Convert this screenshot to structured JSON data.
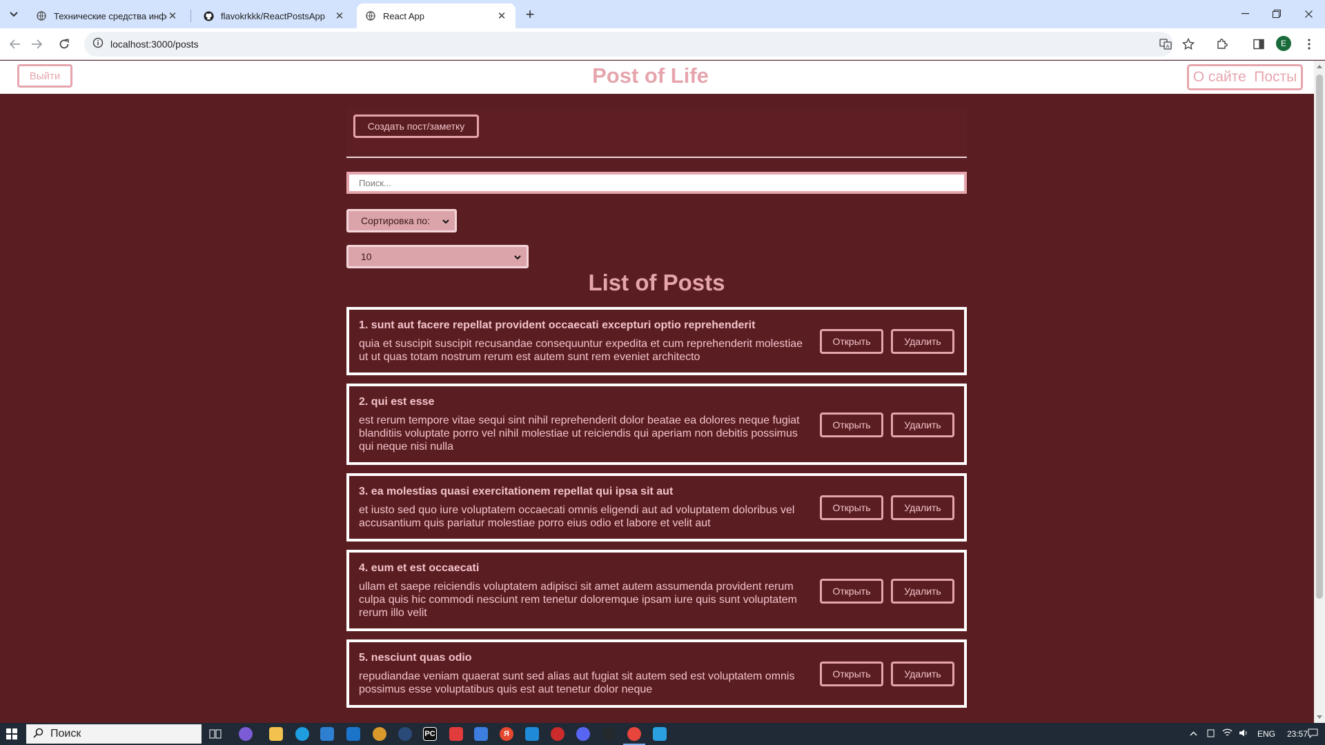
{
  "browser": {
    "tabs": [
      {
        "title": "Технические средства инфор…",
        "icon": "globe-icon"
      },
      {
        "title": "flavokrkkk/ReactPostsApp",
        "icon": "github-icon"
      },
      {
        "title": "React App",
        "icon": "globe-icon"
      }
    ],
    "url": "localhost:3000/posts",
    "profile_initial": "E"
  },
  "header": {
    "logout_label": "Выйти",
    "title": "Post of Life",
    "nav": [
      "О сайте",
      "Посты"
    ]
  },
  "toolbar": {
    "create_label": "Создать пост/заметку",
    "search_placeholder": "Поиск...",
    "sort_label": "Сортировка по:",
    "limit_value": "10"
  },
  "list_title": "List of Posts",
  "post_actions": {
    "open": "Открыть",
    "delete": "Удалить"
  },
  "posts": [
    {
      "title": "1. sunt aut facere repellat provident occaecati excepturi optio reprehenderit",
      "body": "quia et suscipit suscipit recusandae consequuntur expedita et cum reprehenderit molestiae ut ut quas totam nostrum rerum est autem sunt rem eveniet architecto"
    },
    {
      "title": "2. qui est esse",
      "body": "est rerum tempore vitae sequi sint nihil reprehenderit dolor beatae ea dolores neque fugiat blanditiis voluptate porro vel nihil molestiae ut reiciendis qui aperiam non debitis possimus qui neque nisi nulla"
    },
    {
      "title": "3. ea molestias quasi exercitationem repellat qui ipsa sit aut",
      "body": "et iusto sed quo iure voluptatem occaecati omnis eligendi aut ad voluptatem doloribus vel accusantium quis pariatur molestiae porro eius odio et labore et velit aut"
    },
    {
      "title": "4. eum et est occaecati",
      "body": "ullam et saepe reiciendis voluptatem adipisci sit amet autem assumenda provident rerum culpa quis hic commodi nesciunt rem tenetur doloremque ipsam iure quis sunt voluptatem rerum illo velit"
    },
    {
      "title": "5. nesciunt quas odio",
      "body": "repudiandae veniam quaerat sunt sed alias aut fugiat sit autem sed est voluptatem omnis possimus esse voluptatibus quis est aut tenetur dolor neque"
    }
  ],
  "taskbar": {
    "search_label": "Поиск",
    "language": "ENG",
    "time": "23:57"
  },
  "colors": {
    "background": "#5a1d22",
    "accent": "#e6a5ad",
    "select": "#dba3aa"
  }
}
